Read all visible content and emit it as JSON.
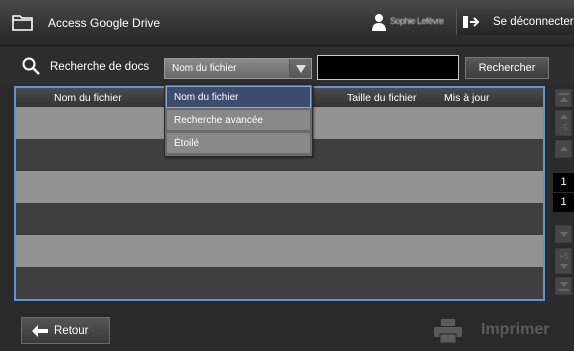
{
  "header": {
    "app_title": "Access Google Drive",
    "user_name": "Sophie Lefèvre",
    "logout_label": "Se déconnecter"
  },
  "search": {
    "label": "Recherche de docs",
    "selected_option": "Nom du fichier",
    "input_value": "",
    "button_label": "Rechercher",
    "dropdown_options": [
      "Nom du fichier",
      "Recherche avancée",
      "Étoilé"
    ],
    "dropdown_expanded": true
  },
  "table": {
    "columns": [
      "Nom du fichier",
      "Taille du fichier",
      "Mis à jour"
    ],
    "rows": [],
    "visible_row_slots": 6
  },
  "pagination": {
    "current_page": "1",
    "total_pages": "1",
    "up_step_label": "-5",
    "down_step_label": "+5"
  },
  "footer": {
    "back_label": "Retour",
    "print_label": "Imprimer",
    "print_enabled": false
  },
  "colors": {
    "selection_border": "#5f93d8",
    "row_light": "#929292",
    "row_dark": "#3f3f3f"
  }
}
